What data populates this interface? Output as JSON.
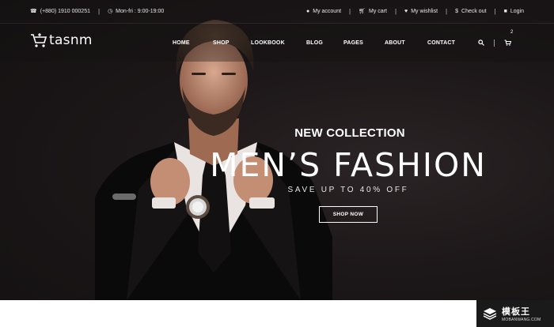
{
  "topbar": {
    "phone": "(+880) 1910 000251",
    "hours": "Mon-fri : 9:00-19:00",
    "links": [
      {
        "label": "My account",
        "icon": "user-icon"
      },
      {
        "label": "My cart",
        "icon": "cart-icon"
      },
      {
        "label": "My wishlist",
        "icon": "heart-icon"
      },
      {
        "label": "Check out",
        "icon": "dollar-icon"
      },
      {
        "label": "Login",
        "icon": "lock-icon"
      }
    ]
  },
  "nav": {
    "logo": "tasnm",
    "menu": [
      "HOME",
      "SHOP",
      "LOOKBOOK",
      "BLOG",
      "PAGES",
      "ABOUT",
      "CONTACT"
    ],
    "cart_count": "2"
  },
  "hero": {
    "kicker": "NEW COLLECTION",
    "headline": "MEN’S FASHION",
    "subline": "SAVE UP TO 40% OFF",
    "cta": "SHOP NOW"
  },
  "watermark": {
    "title": "模板王",
    "url": "MOBANWANG.COM"
  },
  "colors": {
    "hero_bg": "#1c1718",
    "text": "#ffffff"
  }
}
